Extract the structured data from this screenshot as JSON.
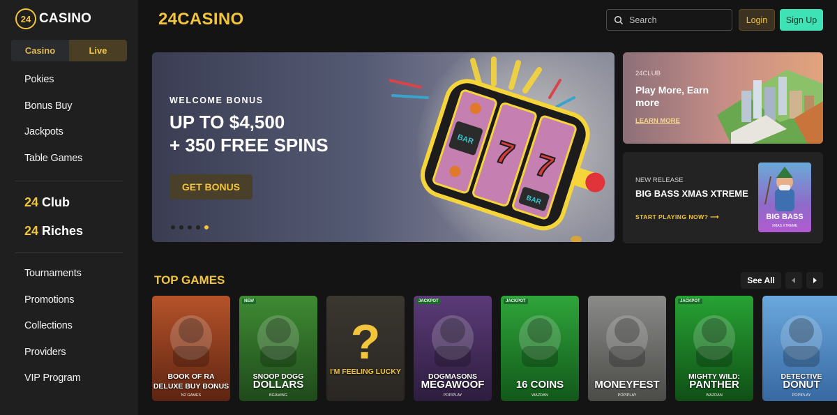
{
  "brand": {
    "logo_number": "24",
    "logo_text": "CASINO",
    "header_title": "24CASINO"
  },
  "mode_toggle": {
    "casino": "Casino",
    "live": "Live"
  },
  "nav": {
    "group1": [
      "Pokies",
      "Bonus Buy",
      "Jackpots",
      "Table Games"
    ],
    "club_num": "24",
    "club_label": " Club",
    "riches_num": "24",
    "riches_label": " Riches",
    "group2": [
      "Tournaments",
      "Promotions",
      "Collections",
      "Providers",
      "VIP Program"
    ]
  },
  "header": {
    "search_placeholder": "Search",
    "login": "Login",
    "signup": "Sign Up"
  },
  "hero": {
    "kicker": "WELCOME BONUS",
    "line1": "UP TO $4,500",
    "line2": "+ 350 FREE SPINS",
    "cta": "GET BONUS",
    "slide_count": 5,
    "active_slide": 5,
    "reel_symbols": [
      "BAR",
      "7",
      "BAR"
    ]
  },
  "promo_club": {
    "tag": "24CLUB",
    "title": "Play More, Earn more",
    "link": "LEARN MORE"
  },
  "promo_release": {
    "tag": "NEW RELEASE",
    "title": "BIG BASS XMAS XTREME",
    "link": "START PLAYING NOW?",
    "thumb_title": "BIG BASS",
    "thumb_sub": "XMAS XTREME"
  },
  "top_games": {
    "title": "TOP GAMES",
    "see_all": "See All",
    "games": [
      {
        "badge": "",
        "name1": "BOOK OF RA",
        "name2": "DELUXE BUY BONUS",
        "provider": "N2 GAMES",
        "bg": "#b5532a",
        "bg2": "#5e2411",
        "icon": "book-of-ra-icon"
      },
      {
        "badge": "NEW",
        "name1": "SNOOP DOGG",
        "name2": "DOLLARS",
        "provider": "BGAMING",
        "bg": "#3f8b33",
        "bg2": "#1f4a1b",
        "icon": "snoop-dogg-icon"
      },
      {
        "badge": "",
        "name1": "",
        "name2": "I'M FEELING LUCKY",
        "provider": "",
        "bg": "#3a3630",
        "bg2": "#2a2723",
        "icon": "question-mark-icon"
      },
      {
        "badge": "JACKPOT",
        "name1": "DOGMASONS",
        "name2": "MEGAWOOF",
        "provider": "POPIPLAY",
        "bg": "#5b3b78",
        "bg2": "#2e1d3f",
        "icon": "dog-icon"
      },
      {
        "badge": "JACKPOT",
        "name1": "",
        "name2": "16 COINS",
        "provider": "WAZDAN",
        "bg": "#2fa53a",
        "bg2": "#12581a",
        "icon": "treasure-chest-icon"
      },
      {
        "badge": "",
        "name1": "",
        "name2": "MONEYFEST",
        "provider": "POPIPLAY",
        "bg": "#8a8a88",
        "bg2": "#4b4b48",
        "icon": "piggy-bank-icon"
      },
      {
        "badge": "JACKPOT",
        "name1": "MIGHTY WILD:",
        "name2": "PANTHER",
        "provider": "WAZDAN",
        "bg": "#27a334",
        "bg2": "#0f4f15",
        "icon": "panther-icon"
      },
      {
        "badge": "",
        "name1": "DETECTIVE",
        "name2": "DONUT",
        "provider": "POPIPLAY",
        "bg": "#6aa8de",
        "bg2": "#3768a1",
        "icon": "detective-icon"
      }
    ]
  },
  "colors": {
    "accent": "#f2c53d",
    "signup": "#3ee2b4",
    "sidebar": "#1f1f1f",
    "background": "#141414"
  }
}
